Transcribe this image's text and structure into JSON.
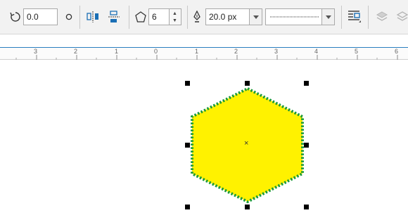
{
  "toolbar": {
    "rotation_value": "0.0",
    "sides_value": "6",
    "outline_width": "20.0 px",
    "line_style": "dotted",
    "icons": [
      "rotate-icon",
      "lock-ratio-icon",
      "mirror-horizontal-icon",
      "mirror-vertical-icon",
      "polygon-icon",
      "pen-outline-icon",
      "wrap-text-icon",
      "arrange-front-icon",
      "arrange-back-icon"
    ]
  },
  "ruler": {
    "ticks": [
      "3",
      "2",
      "1",
      "0",
      "1",
      "2",
      "3",
      "4",
      "5",
      "6"
    ]
  },
  "canvas": {
    "shape": "hexagon",
    "fill_color": "#fff200",
    "outline_color": "#1a9a3a",
    "center_mark": "×"
  },
  "colors": {
    "accent": "#2a7fc0",
    "toolbar_bg": "#f2f2f2"
  }
}
